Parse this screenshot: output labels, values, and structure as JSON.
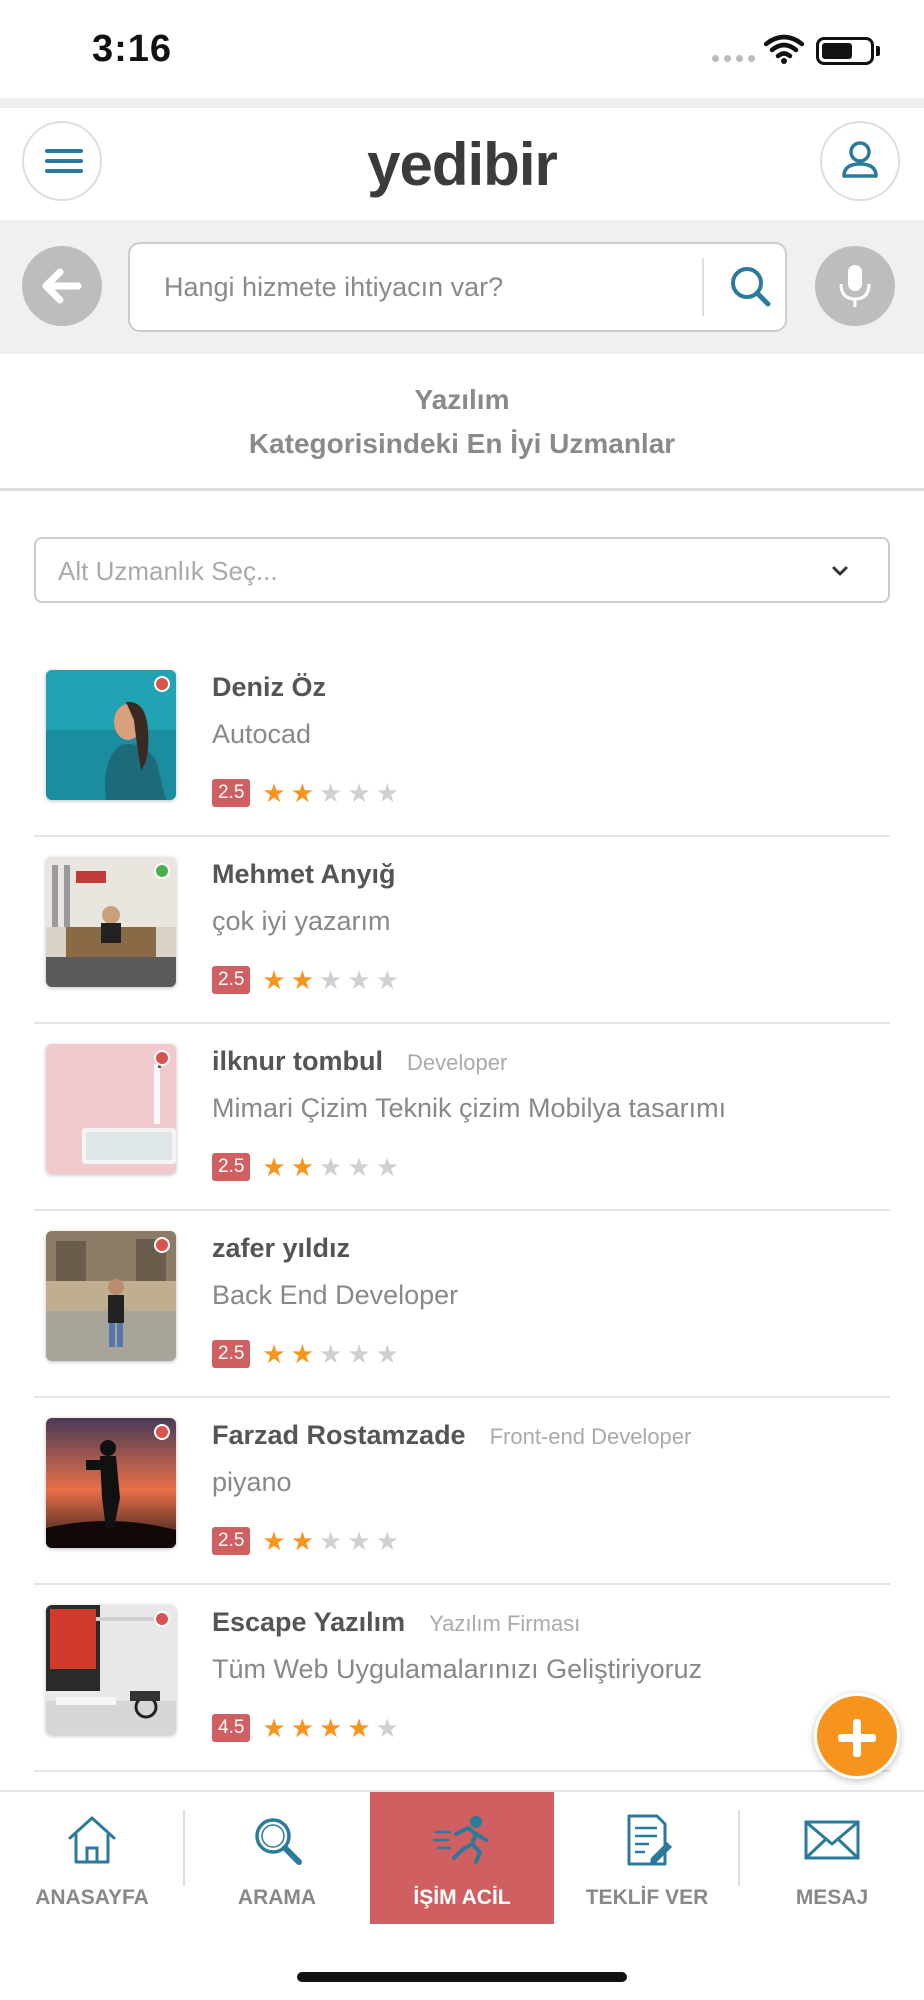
{
  "status_bar": {
    "time": "3:16"
  },
  "header": {
    "logo": "yedibir"
  },
  "search": {
    "placeholder": "Hangi hizmete ihtiyacın var?"
  },
  "category": {
    "line1": "Yazılım",
    "line2": "Kategorisindeki En İyi Uzmanlar"
  },
  "filter": {
    "placeholder": "Alt Uzmanlık Seç..."
  },
  "experts": [
    {
      "name": "Deniz Öz",
      "title": "",
      "description": "Autocad",
      "rating": "2.5",
      "stars": 2,
      "online": false
    },
    {
      "name": "Mehmet Anyığ",
      "title": "",
      "description": "çok iyi yazarım",
      "rating": "2.5",
      "stars": 2,
      "online": true
    },
    {
      "name": "ilknur tombul",
      "title": "Developer",
      "description": "Mimari Çizim Teknik çizim Mobilya tasarımı",
      "rating": "2.5",
      "stars": 2,
      "online": false
    },
    {
      "name": "zafer yıldız",
      "title": "",
      "description": "Back End Developer",
      "rating": "2.5",
      "stars": 2,
      "online": false
    },
    {
      "name": "Farzad Rostamzade",
      "title": "Front-end Developer",
      "description": "piyano",
      "rating": "2.5",
      "stars": 2,
      "online": false
    },
    {
      "name": "Escape Yazılım",
      "title": "Yazılım Firması",
      "description": "Tüm Web Uygulamalarınızı Geliştiriyoruz",
      "rating": "4.5",
      "stars": 4,
      "online": false
    }
  ],
  "bottom_nav": [
    {
      "label": "ANASAYFA",
      "icon": "home-icon",
      "active": false
    },
    {
      "label": "ARAMA",
      "icon": "search-icon",
      "active": false
    },
    {
      "label": "İŞİM ACİL",
      "icon": "running-man-icon",
      "active": true
    },
    {
      "label": "TEKLİF VER",
      "icon": "document-edit-icon",
      "active": false
    },
    {
      "label": "MESAJ",
      "icon": "envelope-icon",
      "active": false
    }
  ],
  "colors": {
    "brand_blue": "#2b7a9c",
    "accent_red": "#cf5f61",
    "accent_orange": "#f7941d",
    "online_green": "#4caf50",
    "offline_red": "#d9534f"
  }
}
